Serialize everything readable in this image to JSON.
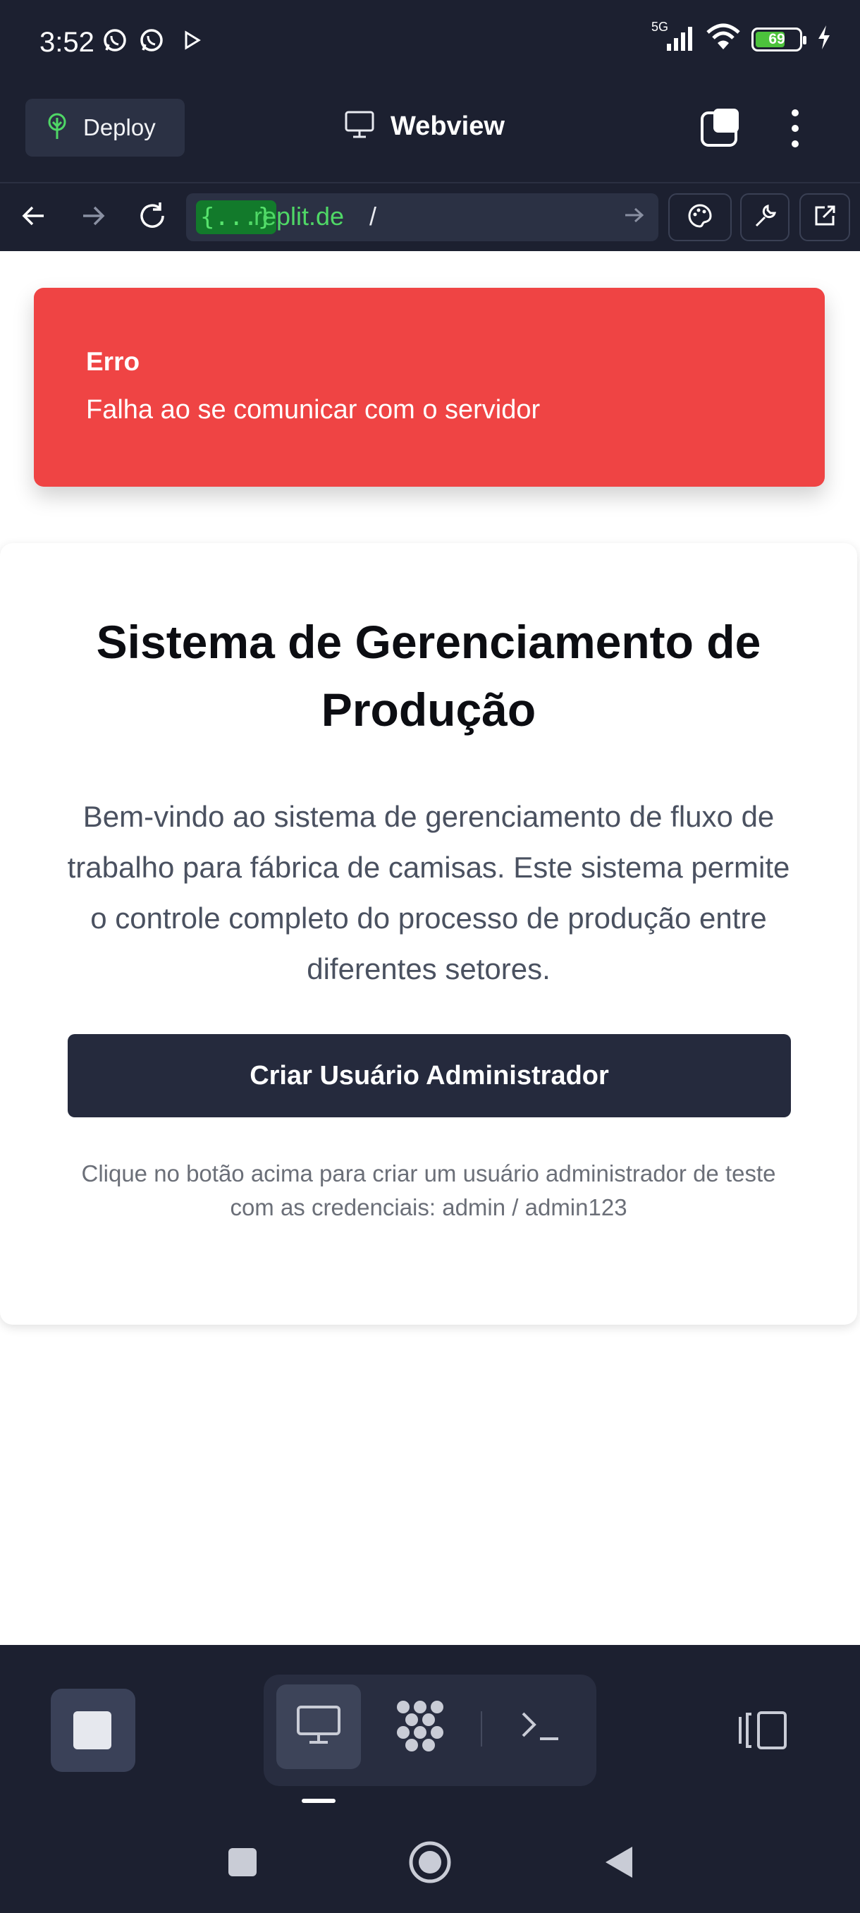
{
  "status_bar": {
    "time": "3:52",
    "network": "5G",
    "battery": "69",
    "battery_level": 0.69,
    "icons": [
      "whatsapp-icon",
      "whatsapp-icon",
      "play-store-icon",
      "signal-icon",
      "wifi-icon",
      "battery-icon",
      "charging-bolt-icon"
    ]
  },
  "app_bar": {
    "deploy_label": "Deploy",
    "title": "Webview",
    "icons": [
      "deploy-icon",
      "monitor-icon",
      "tabs-icon",
      "more-vertical-icon"
    ]
  },
  "url_bar": {
    "badge": "{...}",
    "host": ".replit.de",
    "path": "/",
    "icons": [
      "back-icon",
      "forward-icon",
      "reload-icon",
      "go-arrow-icon",
      "palette-icon",
      "wrench-icon",
      "open-external-icon"
    ]
  },
  "toast": {
    "title": "Erro",
    "message": "Falha ao se comunicar com o servidor"
  },
  "page": {
    "title": "Sistema de Gerenciamento de Produção",
    "description": "Bem-vindo ao sistema de gerenciamento de fluxo de trabalho para fábrica de camisas. Este sistema permite o controle completo do processo de produção entre diferentes setores.",
    "button_label": "Criar Usuário Administrador",
    "helper_text": "Clique no botão acima para criar um usuário administrador de teste com as credenciais: admin / admin123"
  },
  "bottom_toolbar": {
    "icons": [
      "stop-icon",
      "desktop-icon",
      "workspace-icon",
      "terminal-icon",
      "dock-icon"
    ]
  },
  "system_nav": {
    "icons": [
      "recents-icon",
      "home-icon",
      "back-triangle-icon"
    ]
  },
  "colors": {
    "background": "#1c2030",
    "error": "#ef4444",
    "primary_button": "#252a3d",
    "url_green": "#4fd766"
  }
}
